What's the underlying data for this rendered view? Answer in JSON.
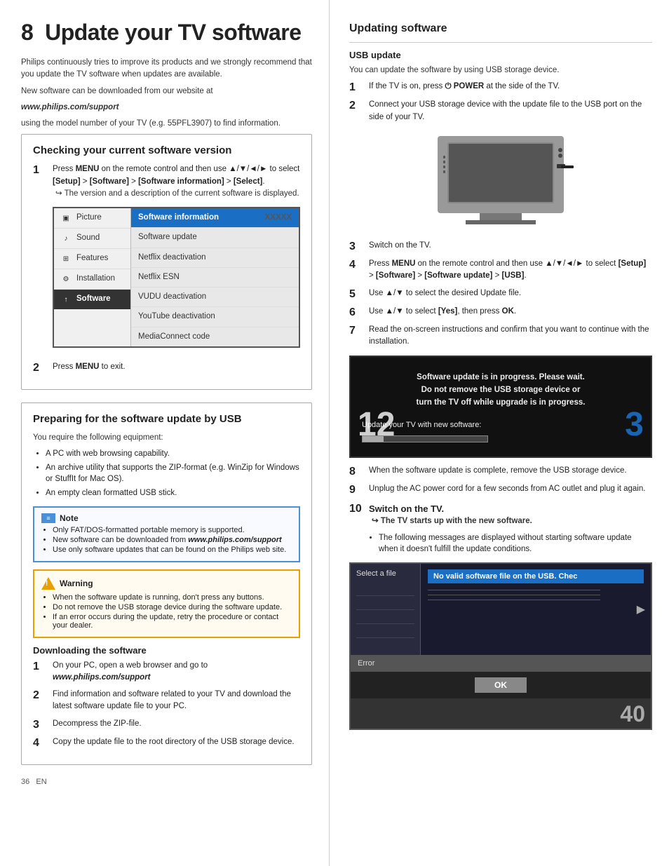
{
  "page": {
    "chapter": "8",
    "title": "Update your TV software",
    "left_intro": [
      "Philips continuously tries to improve its products and we strongly recommend that you update the TV software when updates are available.",
      "New software can be downloaded from our website at"
    ],
    "website": "www.philips.com/support",
    "website_note": "using the model number of your TV (e.g. 55PFL3907) to find information.",
    "checking_section": {
      "title": "Checking your current software version",
      "step1_text": "Press MENU on the remote control and then use ▲/▼/◄/► to select [Setup] > [Software] > [Software information] > [Select].",
      "step1_sub": "The version and a description of the current software is displayed.",
      "step2": "Press MENU to exit.",
      "menu": {
        "items": [
          {
            "label": "Picture",
            "icon": "picture"
          },
          {
            "label": "Sound",
            "icon": "sound",
            "selected": false
          },
          {
            "label": "Features",
            "icon": "features"
          },
          {
            "label": "Installation",
            "icon": "installation"
          },
          {
            "label": "Software",
            "icon": "software",
            "selected": true
          }
        ],
        "subitems": [
          {
            "label": "Software information",
            "value": "XXXXX",
            "highlighted": true
          },
          {
            "label": "Software update"
          },
          {
            "label": "Netflix deactivation"
          },
          {
            "label": "Netflix ESN"
          },
          {
            "label": "VUDU deactivation"
          },
          {
            "label": "YouTube deactivation"
          },
          {
            "label": "MediaConnect code"
          }
        ]
      }
    },
    "preparing_section": {
      "title": "Preparing for the software update by USB",
      "intro": "You require the following equipment:",
      "bullets": [
        "A PC with web browsing capability.",
        "An archive utility that supports the ZIP-format (e.g. WinZip for Windows or StuffIt for Mac OS).",
        "An empty clean formatted USB stick."
      ],
      "note": {
        "header": "Note",
        "items": [
          "Only FAT/DOS-formatted portable memory is supported.",
          "New software can be downloaded from www.philips.com/support",
          "Use only software updates that can be found on the Philips web site."
        ]
      },
      "warning": {
        "header": "Warning",
        "items": [
          "When the software update is running, don't press any buttons.",
          "Do not remove the USB storage device during the software update.",
          "If an error occurs during the update, retry the procedure or contact your dealer."
        ]
      },
      "downloading": {
        "title": "Downloading the software",
        "steps": [
          {
            "text": "On your PC, open a web browser and go to www.philips.com/support",
            "bold_part": "www.philips.com/support"
          },
          {
            "text": "Find information and software related to your TV and download the latest software update file to your PC."
          },
          {
            "text": "Decompress the ZIP-file."
          },
          {
            "text": "Copy the update file to the root directory of the USB storage device."
          }
        ]
      }
    },
    "right_section": {
      "title": "Updating software",
      "usb_update": {
        "title": "USB update",
        "intro": "You can update the software by using USB storage device.",
        "steps": [
          {
            "text": "If the TV is on, press ⏻ POWER at the side of the TV."
          },
          {
            "text": "Connect your USB storage device with the update file to the USB port on the side of your TV."
          },
          {
            "text": "Switch on the TV."
          },
          {
            "text": "Press MENU on the remote control and then use ▲/▼/◄/► to select [Setup] > [Software] > [Software update] > [USB]."
          },
          {
            "text": "Use ▲/▼ to select the desired Update file."
          },
          {
            "text": "Use ▲/▼ to select [Yes], then press OK."
          },
          {
            "text": "Read the on-screen instructions and confirm that you want to continue with the installation."
          },
          {
            "text": "When the software update is complete, remove the USB storage device."
          },
          {
            "text": "Unplug the AC power cord for a few seconds from AC outlet and plug it again."
          },
          {
            "text": "Switch on the TV.",
            "sub": "The TV starts up with the new software."
          },
          {
            "text": "The following messages are displayed without starting software update when it doesn't fulfill the update conditions."
          }
        ],
        "progress_screen": {
          "line1": "Software update is in progress. Please wait.",
          "line2": "Do not remove the USB storage device or",
          "line3": "turn the TV off while upgrade is in progress.",
          "update_label": "Update your TV with new software:",
          "corner_left": "12",
          "corner_right": "3"
        },
        "error_screen": {
          "select_file_label": "Select a file",
          "error_message": "No valid software file on the USB. Chec",
          "error_label": "Error",
          "ok_label": "OK",
          "corner_num": "40"
        }
      }
    },
    "page_number": "36",
    "lang": "EN"
  }
}
